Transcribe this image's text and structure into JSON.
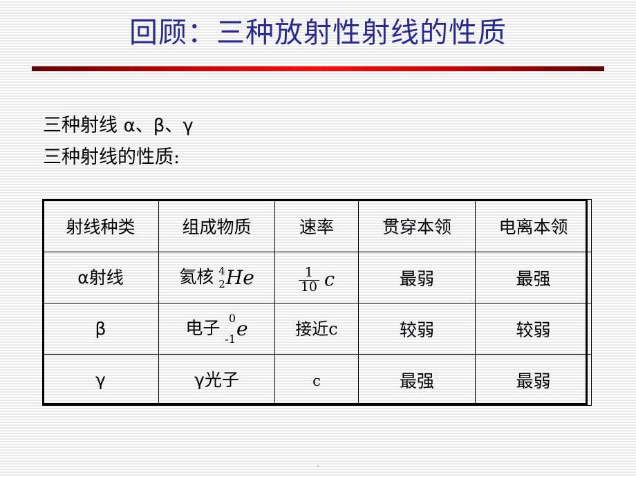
{
  "slide": {
    "title": "回顾：三种放射性射线的性质",
    "title_color": "#2b2b8f",
    "rule_color": "#f80d0d",
    "page_mark": "."
  },
  "body": {
    "line1_prefix": "三种射线",
    "line1_greek": "α、β、γ",
    "line2": "三种射线的性质:"
  },
  "table": {
    "headers": [
      "射线种类",
      "组成物质",
      "速率",
      "贯穿本领",
      "电离本领"
    ],
    "rows": [
      {
        "kind": "α射线",
        "composition_label": "氦核",
        "composition_mass": "4",
        "composition_charge": "2",
        "composition_symbol": "He",
        "speed_numerator": "1",
        "speed_denominator": "10",
        "speed_symbol": "c",
        "penetration": "最弱",
        "ionization": "最强"
      },
      {
        "kind": "β",
        "composition_label": "电子",
        "composition_mass": "0",
        "composition_charge": "-1",
        "composition_symbol": "e",
        "speed": "接近c",
        "penetration": "较弱",
        "ionization": "较弱"
      },
      {
        "kind": "γ",
        "composition": "γ光子",
        "speed": "c",
        "penetration": "最强",
        "ionization": "最弱"
      }
    ]
  }
}
